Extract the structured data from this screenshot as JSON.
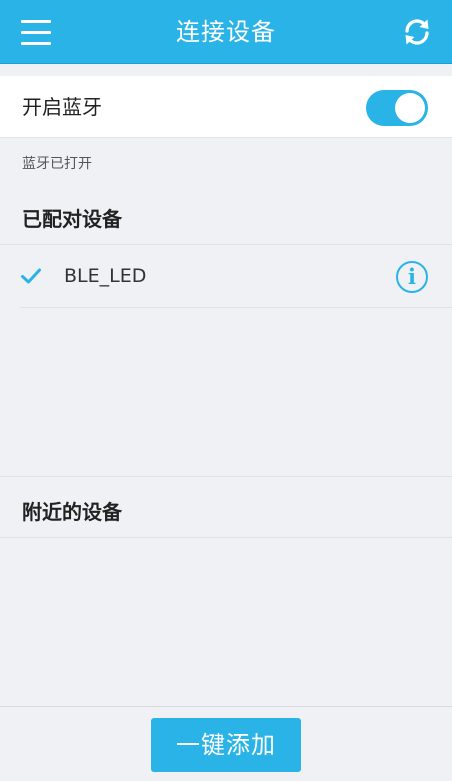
{
  "header": {
    "title": "连接设备",
    "menu_icon": "menu-icon",
    "refresh_icon": "refresh-icon",
    "color": "#2ab3e7"
  },
  "bluetooth": {
    "label": "开启蓝牙",
    "enabled": true,
    "status": "蓝牙已打开"
  },
  "paired": {
    "title": "已配对设备",
    "devices": [
      {
        "name": "BLE_LED",
        "connected": true,
        "check_icon": "check-icon",
        "info_icon": "info-icon",
        "info_glyph": "i"
      }
    ]
  },
  "nearby": {
    "title": "附近的设备",
    "devices": []
  },
  "footer": {
    "add_all_label": "一键添加"
  }
}
